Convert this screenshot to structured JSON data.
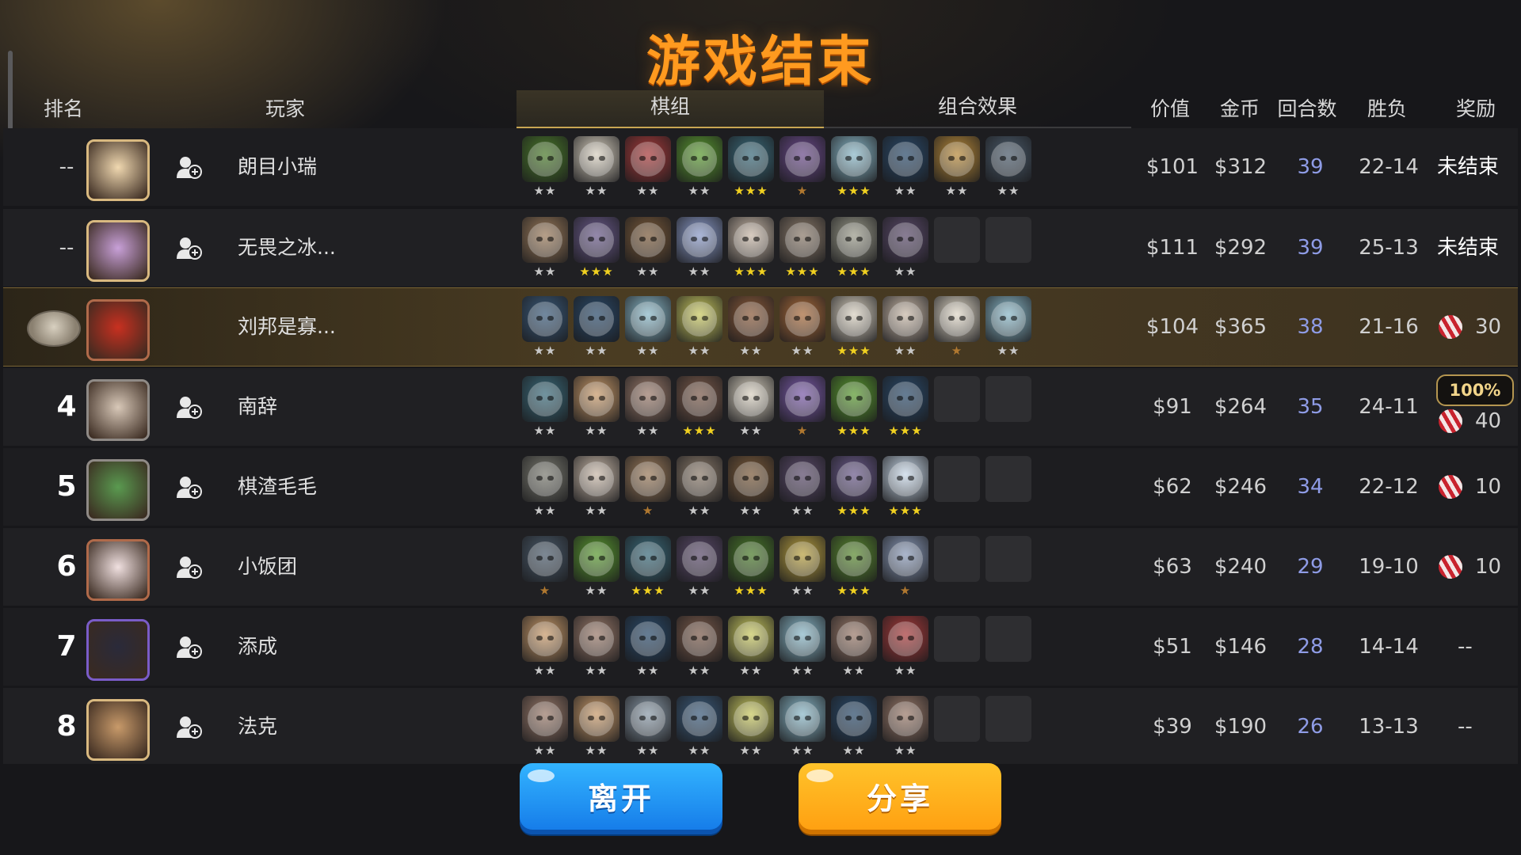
{
  "title": "游戏结束",
  "headers": {
    "rank": "排名",
    "player": "玩家",
    "tab_lineup": "棋组",
    "tab_synergy": "组合效果",
    "value": "价值",
    "gold": "金币",
    "rounds": "回合数",
    "winloss": "胜负",
    "reward": "奖励"
  },
  "rows": [
    {
      "rank": "--",
      "name": "朗目小瑞",
      "value": "$101",
      "gold": "$312",
      "rounds": "39",
      "winloss": "22-14",
      "reward": "未结束",
      "units": [
        {
          "c": "#4a7a2a",
          "s": "★★"
        },
        {
          "c": "#d8d0c0",
          "s": "★★"
        },
        {
          "c": "#a83a3a",
          "s": "★★"
        },
        {
          "c": "#5a9a30",
          "s": "★★"
        },
        {
          "c": "#3a6a7a",
          "s": "★★★"
        },
        {
          "c": "#6a4a8a",
          "s": "★"
        },
        {
          "c": "#8ab8c8",
          "s": "★★★"
        },
        {
          "c": "#2a4a6a",
          "s": "★★"
        },
        {
          "c": "#b88a3a",
          "s": "★★"
        },
        {
          "c": "#4a5a6a",
          "s": "★★"
        }
      ]
    },
    {
      "rank": "--",
      "name": "无畏之冰...",
      "value": "$111",
      "gold": "$292",
      "rounds": "39",
      "winloss": "25-13",
      "reward": "未结束",
      "units": [
        {
          "c": "#9a7a5a",
          "s": "★★"
        },
        {
          "c": "#6a5a8a",
          "s": "★★★"
        },
        {
          "c": "#7a5a3a",
          "s": "★★"
        },
        {
          "c": "#8a9ac8",
          "s": "★★"
        },
        {
          "c": "#c8b8a8",
          "s": "★★★"
        },
        {
          "c": "#8a7a6a",
          "s": "★★★"
        },
        {
          "c": "#9a9a8a",
          "s": "★★★"
        },
        {
          "c": "#5a4a6a",
          "s": "★★"
        }
      ]
    },
    {
      "rank": "",
      "name": "刘邦是寡...",
      "value": "$104",
      "gold": "$365",
      "rounds": "38",
      "winloss": "21-16",
      "reward": "30",
      "units": [
        {
          "c": "#3a5a7a",
          "s": "★★"
        },
        {
          "c": "#2a4a6a",
          "s": "★★"
        },
        {
          "c": "#8ab8c8",
          "s": "★★"
        },
        {
          "c": "#c8c860",
          "s": "★★"
        },
        {
          "c": "#8a5a3a",
          "s": "★★"
        },
        {
          "c": "#a86a3a",
          "s": "★★"
        },
        {
          "c": "#d8d0c0",
          "s": "★★★"
        },
        {
          "c": "#c8b8a8",
          "s": "★★"
        },
        {
          "c": "#e0d8c8",
          "s": "★"
        },
        {
          "c": "#8ab8c8",
          "s": "★★"
        }
      ]
    },
    {
      "rank": "4",
      "name": "南辞",
      "value": "$91",
      "gold": "$264",
      "rounds": "35",
      "winloss": "24-11",
      "reward": "40",
      "bonus": "100%",
      "units": [
        {
          "c": "#3a6a7a",
          "s": "★★"
        },
        {
          "c": "#c89a6a",
          "s": "★★"
        },
        {
          "c": "#9a7a6a",
          "s": "★★"
        },
        {
          "c": "#7a5a4a",
          "s": "★★★"
        },
        {
          "c": "#d8d0c0",
          "s": "★★"
        },
        {
          "c": "#7a5aa8",
          "s": "★"
        },
        {
          "c": "#5a9a30",
          "s": "★★★"
        },
        {
          "c": "#2a4a6a",
          "s": "★★★"
        }
      ]
    },
    {
      "rank": "5",
      "name": "棋渣毛毛",
      "value": "$62",
      "gold": "$246",
      "rounds": "34",
      "winloss": "22-12",
      "reward": "10",
      "units": [
        {
          "c": "#7a7a70",
          "s": "★★"
        },
        {
          "c": "#c8b8a8",
          "s": "★★"
        },
        {
          "c": "#9a7a5a",
          "s": "★"
        },
        {
          "c": "#8a7a6a",
          "s": "★★"
        },
        {
          "c": "#7a5a3a",
          "s": "★★"
        },
        {
          "c": "#5a4a6a",
          "s": "★★"
        },
        {
          "c": "#6a5a8a",
          "s": "★★★"
        },
        {
          "c": "#c8d8e8",
          "s": "★★★"
        }
      ]
    },
    {
      "rank": "6",
      "name": "小饭团",
      "value": "$63",
      "gold": "$240",
      "rounds": "29",
      "winloss": "19-10",
      "reward": "10",
      "units": [
        {
          "c": "#4a5a6a",
          "s": "★"
        },
        {
          "c": "#5a9a30",
          "s": "★★"
        },
        {
          "c": "#3a6a7a",
          "s": "★★★"
        },
        {
          "c": "#5a4a6a",
          "s": "★★"
        },
        {
          "c": "#4a7a2a",
          "s": "★★★"
        },
        {
          "c": "#b8a040",
          "s": "★★"
        },
        {
          "c": "#5a8a30",
          "s": "★★★"
        },
        {
          "c": "#8a9ab8",
          "s": "★"
        }
      ]
    },
    {
      "rank": "7",
      "name": "添成",
      "value": "$51",
      "gold": "$146",
      "rounds": "28",
      "winloss": "14-14",
      "reward": "--",
      "units": [
        {
          "c": "#c89a6a",
          "s": "★★"
        },
        {
          "c": "#9a7a6a",
          "s": "★★"
        },
        {
          "c": "#2a4a6a",
          "s": "★★"
        },
        {
          "c": "#7a5a4a",
          "s": "★★"
        },
        {
          "c": "#c8c860",
          "s": "★★"
        },
        {
          "c": "#8ab8c8",
          "s": "★★"
        },
        {
          "c": "#9a7a6a",
          "s": "★★"
        },
        {
          "c": "#a83a3a",
          "s": "★★"
        }
      ]
    },
    {
      "rank": "8",
      "name": "法克",
      "value": "$39",
      "gold": "$190",
      "rounds": "26",
      "winloss": "13-13",
      "reward": "--",
      "units": [
        {
          "c": "#9a7a6a",
          "s": "★★"
        },
        {
          "c": "#c89a6a",
          "s": "★★"
        },
        {
          "c": "#8a9aa8",
          "s": "★★"
        },
        {
          "c": "#3a5a7a",
          "s": "★★"
        },
        {
          "c": "#c8c860",
          "s": "★★"
        },
        {
          "c": "#8ab8c8",
          "s": "★★"
        },
        {
          "c": "#2a4a6a",
          "s": "★★"
        },
        {
          "c": "#9a7a6a",
          "s": "★★"
        }
      ]
    }
  ],
  "buttons": {
    "leave": "离开",
    "share": "分享"
  }
}
